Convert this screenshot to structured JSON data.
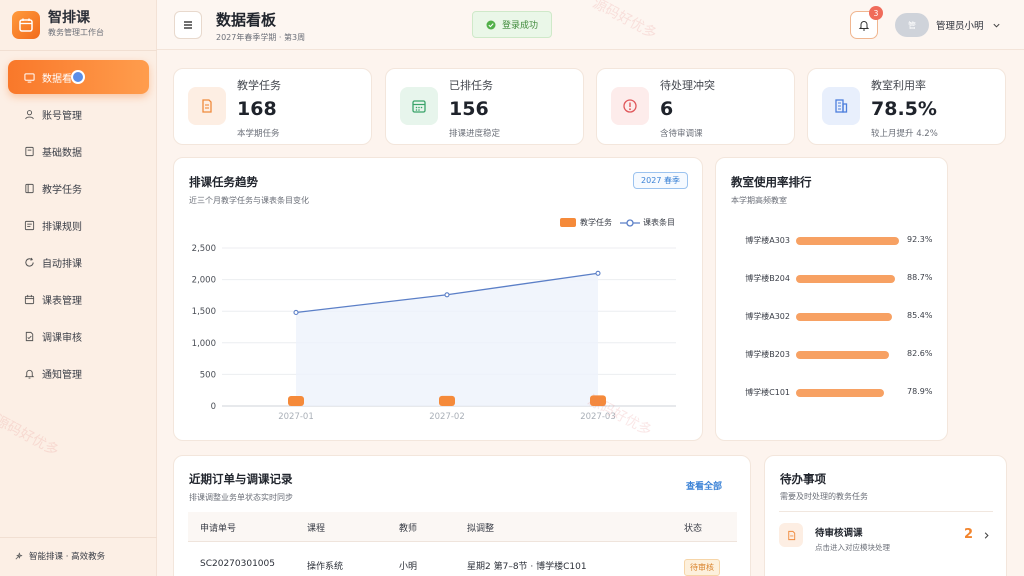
{
  "brand": {
    "name": "智排课",
    "subtitle": "教务管理工作台"
  },
  "sidebar": {
    "items": [
      {
        "label": "数据看板",
        "icon": "dashboard-icon",
        "active": true
      },
      {
        "label": "账号管理",
        "icon": "user-icon"
      },
      {
        "label": "基础数据",
        "icon": "database-icon"
      },
      {
        "label": "教学任务",
        "icon": "book-icon"
      },
      {
        "label": "排课规则",
        "icon": "rules-icon"
      },
      {
        "label": "自动排课",
        "icon": "refresh-icon"
      },
      {
        "label": "课表管理",
        "icon": "calendar-icon"
      },
      {
        "label": "调课审核",
        "icon": "review-icon"
      },
      {
        "label": "通知管理",
        "icon": "bell-icon"
      }
    ],
    "footer": "智能排课 · 高效教务"
  },
  "header": {
    "title": "数据看板",
    "subtitle": "2027年春季学期 · 第3周",
    "toast": "登录成功",
    "notification_count": "3",
    "avatar_text": "管",
    "user_name": "管理员小明"
  },
  "stats": [
    {
      "label": "教学任务",
      "value": "168",
      "note": "本学期任务",
      "color": "#f08a3c",
      "bg": "#fdeee3",
      "icon": "document-icon"
    },
    {
      "label": "已排任务",
      "value": "156",
      "note": "排课进度稳定",
      "color": "#3aa36a",
      "bg": "#e7f5ec",
      "icon": "calendar-icon"
    },
    {
      "label": "待处理冲突",
      "value": "6",
      "note": "含待审调课",
      "color": "#e0575a",
      "bg": "#fdeceb",
      "icon": "alert-icon"
    },
    {
      "label": "教室利用率",
      "value": "78.5%",
      "note": "较上月提升 4.2%",
      "color": "#4d7fdc",
      "bg": "#e8effc",
      "icon": "building-icon"
    }
  ],
  "trend": {
    "title": "排课任务趋势",
    "subtitle": "近三个月教学任务与课表条目变化",
    "tag": "2027 春季"
  },
  "chart_data": {
    "type": "bar",
    "categories": [
      "2027-01",
      "2027-02",
      "2027-03"
    ],
    "series": [
      {
        "name": "教学任务",
        "type": "bar",
        "values": [
          150,
          160,
          168
        ],
        "color": "#f58a3a"
      },
      {
        "name": "课表条目",
        "type": "line",
        "values": [
          1480,
          1760,
          2100
        ],
        "color": "#5b7fc7"
      }
    ],
    "ylim": [
      0,
      2500
    ],
    "yticks": [
      "0",
      "500",
      "1,000",
      "1,500",
      "2,000",
      "2,500"
    ],
    "legend": "top-right",
    "grid": true
  },
  "rank": {
    "title": "教室使用率排行",
    "subtitle": "本学期高频教室",
    "items": [
      {
        "name": "博学楼A303",
        "value": 92.3,
        "label": "92.3%"
      },
      {
        "name": "博学楼B204",
        "value": 88.7,
        "label": "88.7%"
      },
      {
        "name": "博学楼A302",
        "value": 85.4,
        "label": "85.4%"
      },
      {
        "name": "博学楼B203",
        "value": 82.6,
        "label": "82.6%"
      },
      {
        "name": "博学楼C101",
        "value": 78.9,
        "label": "78.9%"
      }
    ]
  },
  "orders": {
    "title": "近期订单与调课记录",
    "subtitle": "排课调整业务单状态实时同步",
    "view_all": "查看全部",
    "columns": [
      "申请单号",
      "课程",
      "教师",
      "拟调整",
      "状态"
    ],
    "rows": [
      {
        "id": "SC20270301005",
        "course": "操作系统",
        "teacher": "小明",
        "change": "星期2 第7–8节 · 博学楼C101",
        "status": "待审核"
      }
    ]
  },
  "todo": {
    "title": "待办事项",
    "subtitle": "需要及时处理的教务任务",
    "items": [
      {
        "title": "待审核调课",
        "sub": "点击进入对应模块处理",
        "count": "2"
      }
    ]
  },
  "watermark": "源码好优多"
}
